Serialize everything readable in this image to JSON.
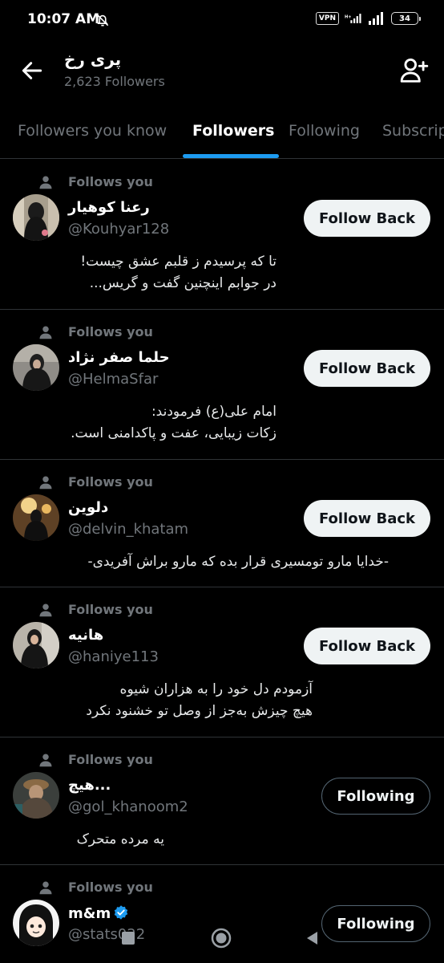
{
  "status_bar": {
    "time": "10:07 AM",
    "vpn_label": "VPN",
    "network_label": "H+",
    "battery": "34"
  },
  "header": {
    "title": "پری رخ",
    "followers_count": "2,623 Followers"
  },
  "tabs": [
    {
      "label": "Followers you know",
      "active": false
    },
    {
      "label": "Followers",
      "active": true
    },
    {
      "label": "Following",
      "active": false
    },
    {
      "label": "Subscriptions",
      "active": false
    }
  ],
  "accent_color": "#1d9bf0",
  "users": [
    {
      "follows_you": "Follows you",
      "name": "رعنا کوهیار",
      "handle": "@Kouhyar128",
      "bio": "تا که پرسیدم ز قلبم عشق چیست!\nدر جوابم اینچنین گفت و گریس...",
      "button": "Follow Back"
    },
    {
      "follows_you": "Follows you",
      "name": "حلما صفر نژاد",
      "handle": "@HelmaSfar",
      "bio": "امام علی(ع) فرمودند:\nزکات زیبایی، عفت و پاکدامنی است.",
      "button": "Follow Back"
    },
    {
      "follows_you": "Follows you",
      "name": "دلوین",
      "handle": "@delvin_khatam",
      "bio": "-خدایا مارو تومسیری قرار بده که مارو براش آفریدی-",
      "button": "Follow Back"
    },
    {
      "follows_you": "Follows you",
      "name": "هانیه",
      "handle": "@haniye113",
      "bio": "آزمودم دل خود را به هزاران شیوه\nهیچ چیزش به‌جز از وصل تو خشنود نکرد",
      "button": "Follow Back"
    },
    {
      "follows_you": "Follows you",
      "name": "هیچ...",
      "handle": "@gol_khanoom2",
      "bio": "یه مرده متحرک",
      "button": "Following"
    },
    {
      "follows_you": "Follows you",
      "name": "m&m",
      "handle": "@stats022",
      "bio": "",
      "button": "Following"
    }
  ],
  "icons": {
    "back": "arrow-left-icon",
    "add_person": "person-add-icon",
    "follows": "person-icon",
    "verified": "verified-badge-icon",
    "mute": "bell-off-icon",
    "nav_home": "circle-home-icon",
    "nav_recents": "square-recents-icon",
    "nav_back": "triangle-back-icon"
  }
}
